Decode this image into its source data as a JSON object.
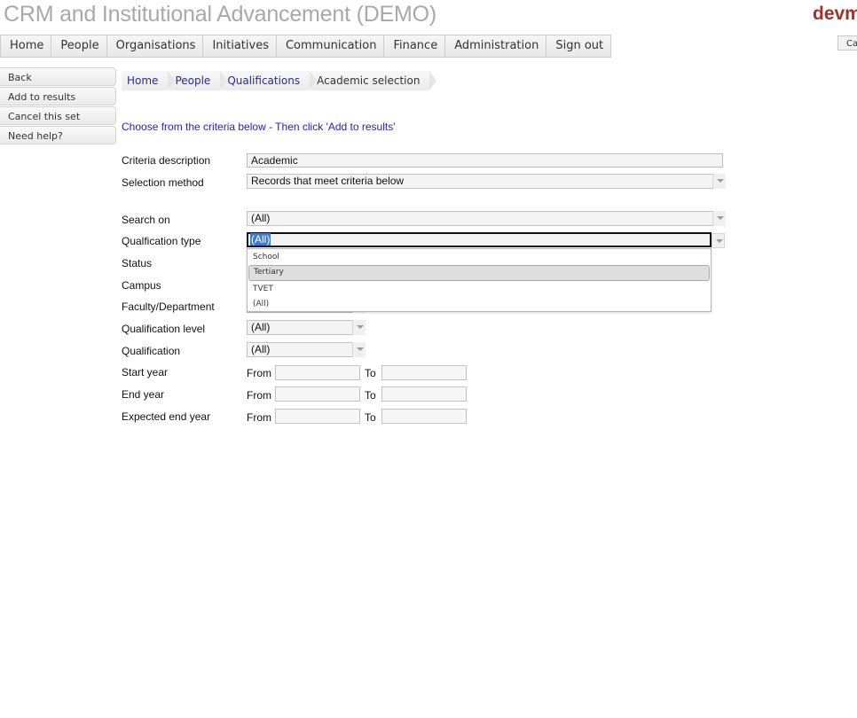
{
  "app": {
    "title": "CRM and Institutional Advancement (DEMO)",
    "brand": "devm",
    "top_right_button": "Ca"
  },
  "nav": {
    "items": [
      "Home",
      "People",
      "Organisations",
      "Initiatives",
      "Communication",
      "Finance",
      "Administration",
      "Sign out"
    ]
  },
  "sidebar": {
    "items": [
      "Back",
      "Add to results",
      "Cancel this set",
      "Need help?"
    ]
  },
  "breadcrumb": {
    "items": [
      "Home",
      "People",
      "Qualifications",
      "Academic selection"
    ]
  },
  "instructions": "Choose from the criteria below - Then click 'Add to results'",
  "form": {
    "criteria_description": {
      "label": "Criteria description",
      "value": "Academic"
    },
    "selection_method": {
      "label": "Selection method",
      "value": "Records that meet criteria below"
    },
    "search_on": {
      "label": "Search on",
      "value": "(All)"
    },
    "qualification_type": {
      "label": "Qualfication type",
      "value": "(All)",
      "options": [
        "School",
        "Tertiary",
        "TVET",
        "(All)"
      ],
      "highlighted_option": "Tertiary"
    },
    "status": {
      "label": "Status"
    },
    "campus": {
      "label": "Campus"
    },
    "faculty": {
      "label": "Faculty/Department"
    },
    "qualification_level": {
      "label": "Qualification level",
      "value": "(All)"
    },
    "qualification": {
      "label": "Qualification",
      "value": "(All)"
    },
    "start_year": {
      "label": "Start year",
      "from": "From",
      "to": "To"
    },
    "end_year": {
      "label": "End year",
      "from": "From",
      "to": "To"
    },
    "expected_end_year": {
      "label": "Expected end year",
      "from": "From",
      "to": "To"
    }
  },
  "colors": {
    "title_gray": "#a9a9a9",
    "brand_red": "#a0322a",
    "instruction_blue": "#1d1dd0",
    "link_blue": "#2b2b8f",
    "selection_highlight": "#3a7bd5"
  }
}
